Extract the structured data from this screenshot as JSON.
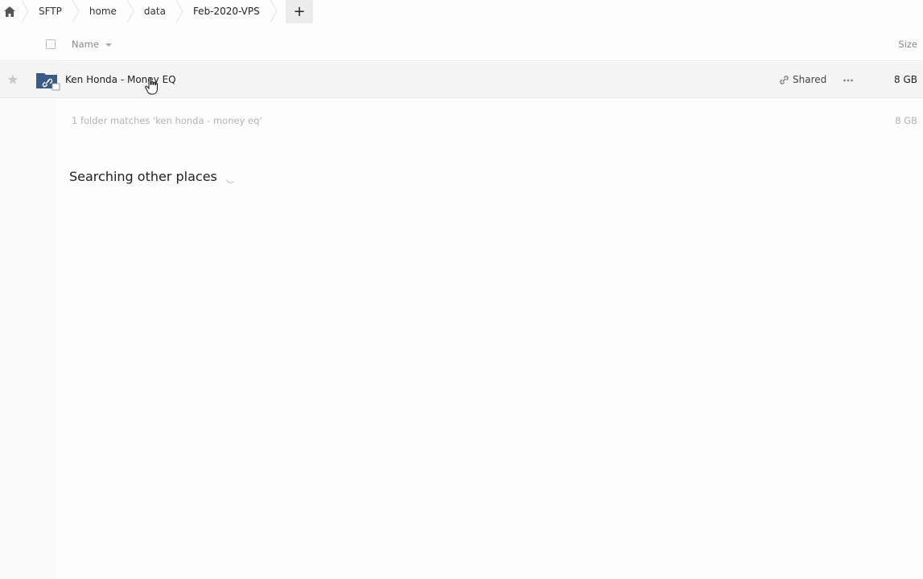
{
  "breadcrumb": {
    "items": [
      {
        "label": "SFTP"
      },
      {
        "label": "home"
      },
      {
        "label": "data"
      },
      {
        "label": "Feb-2020-VPS"
      }
    ],
    "add_label": "+"
  },
  "list_header": {
    "name_label": "Name",
    "size_label": "Size"
  },
  "files": [
    {
      "name": "Ken Honda - Money EQ",
      "shared_label": "Shared",
      "size": "8 GB",
      "icon": "shared-folder-icon"
    }
  ],
  "summary": {
    "text": "1 folder matches 'ken honda - money eq'",
    "size": "8 GB"
  },
  "searching": {
    "label": "Searching other places"
  },
  "colors": {
    "folder": "#3c5a86",
    "row_bg": "#f4f4f4",
    "muted_text": "#b3b3b3"
  }
}
